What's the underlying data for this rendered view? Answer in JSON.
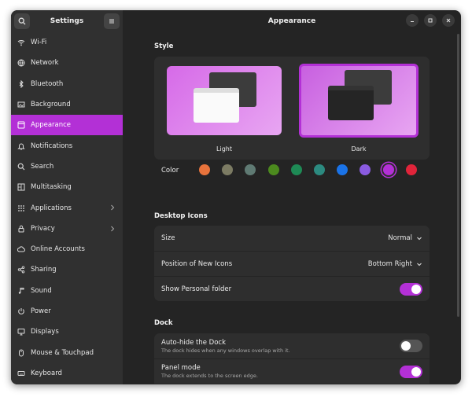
{
  "sidebar": {
    "title": "Settings",
    "items": [
      {
        "label": "Wi-Fi",
        "icon": "wifi-icon"
      },
      {
        "label": "Network",
        "icon": "network-icon"
      },
      {
        "label": "Bluetooth",
        "icon": "bluetooth-icon"
      },
      {
        "label": "Background",
        "icon": "background-icon"
      },
      {
        "label": "Appearance",
        "icon": "appearance-icon",
        "active": true
      },
      {
        "label": "Notifications",
        "icon": "bell-icon"
      },
      {
        "label": "Search",
        "icon": "search-icon"
      },
      {
        "label": "Multitasking",
        "icon": "multitasking-icon"
      },
      {
        "label": "Applications",
        "icon": "apps-grid-icon",
        "chevron": true
      },
      {
        "label": "Privacy",
        "icon": "lock-icon",
        "chevron": true
      },
      {
        "label": "Online Accounts",
        "icon": "cloud-icon"
      },
      {
        "label": "Sharing",
        "icon": "share-icon"
      },
      {
        "label": "Sound",
        "icon": "music-note-icon"
      },
      {
        "label": "Power",
        "icon": "power-icon"
      },
      {
        "label": "Displays",
        "icon": "display-icon"
      },
      {
        "label": "Mouse & Touchpad",
        "icon": "mouse-icon"
      },
      {
        "label": "Keyboard",
        "icon": "keyboard-icon"
      }
    ]
  },
  "header": {
    "title": "Appearance"
  },
  "style": {
    "section_title": "Style",
    "light_label": "Light",
    "dark_label": "Dark",
    "selected": "Dark",
    "color_label": "Color",
    "colors": [
      "#e8733c",
      "#7c7b63",
      "#5f7a73",
      "#4c8a1e",
      "#1e8a55",
      "#2c8a80",
      "#1a73e8",
      "#8a5be0",
      "#b330d6",
      "#e0243a"
    ],
    "selected_color": "#b330d6"
  },
  "desktop_icons": {
    "section_title": "Desktop Icons",
    "size_label": "Size",
    "size_value": "Normal",
    "position_label": "Position of New Icons",
    "position_value": "Bottom Right",
    "personal_folder_label": "Show Personal folder",
    "personal_folder_on": true
  },
  "dock": {
    "section_title": "Dock",
    "autohide_label": "Auto-hide the Dock",
    "autohide_sub": "The dock hides when any windows overlap with it.",
    "autohide_on": false,
    "panel_label": "Panel mode",
    "panel_sub": "The dock extends to the screen edge.",
    "panel_on": true
  },
  "colors": {
    "accent": "#b330d6",
    "window_bg": "#242424",
    "sidebar_bg": "#303030",
    "card_bg": "#2e2e2e"
  }
}
